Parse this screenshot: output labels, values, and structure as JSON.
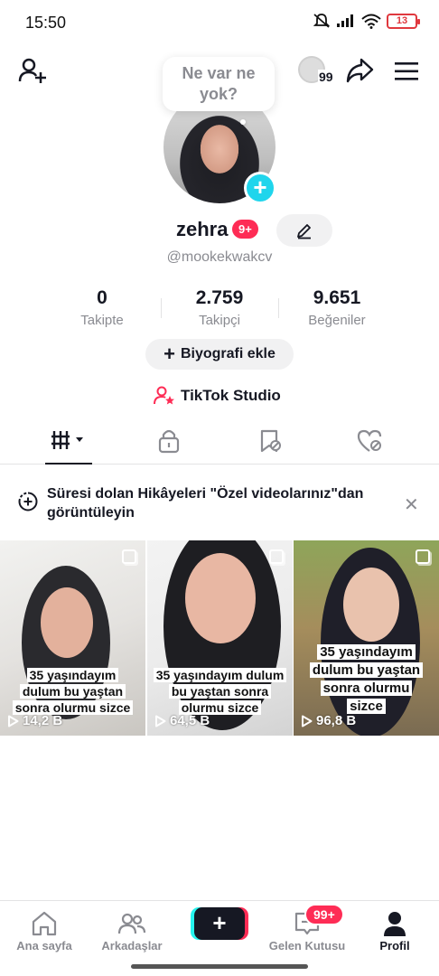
{
  "status_bar": {
    "time": "15:50",
    "battery": "13"
  },
  "top_bar": {
    "coin_count": "99"
  },
  "bubble": {
    "text_line1": "Ne var ne",
    "text_line2": "yok?"
  },
  "profile": {
    "name": "zehra",
    "notif_badge": "9+",
    "handle": "@mookekwakcv"
  },
  "stats": [
    {
      "value": "0",
      "label": "Takipte"
    },
    {
      "value": "2.759",
      "label": "Takipçi"
    },
    {
      "value": "9.651",
      "label": "Beğeniler"
    }
  ],
  "bio_button": "Biyografi ekle",
  "studio_link": "TikTok Studio",
  "notice": {
    "text": "Süresi dolan Hikâyeleri \"Özel videolarınız\"dan görüntüleyin"
  },
  "videos": [
    {
      "caption": [
        "35 yaşındayım",
        "dulum bu yaştan",
        "sonra olurmu sizce"
      ],
      "views": "14,2 B"
    },
    {
      "caption": [
        "35 yaşındayım dulum",
        "bu yaştan sonra",
        "olurmu sizce"
      ],
      "views": "64,5 B"
    },
    {
      "caption": [
        "35 yaşındayım",
        "dulum bu yaştan",
        "sonra olurmu",
        "sizce"
      ],
      "views": "96,8 B"
    }
  ],
  "bottom_nav": {
    "home": "Ana sayfa",
    "friends": "Arkadaşlar",
    "inbox": "Gelen Kutusu",
    "inbox_badge": "99+",
    "profile": "Profil"
  },
  "colors": {
    "accent": "#fe2c55",
    "cyan": "#20d5ec",
    "text": "#161823",
    "muted": "#8a8b91"
  }
}
